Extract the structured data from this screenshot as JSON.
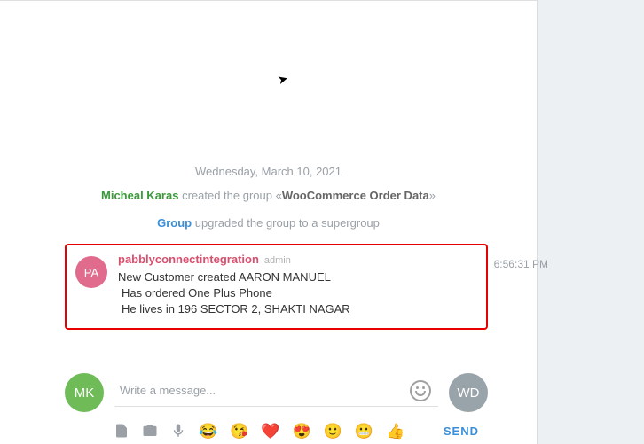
{
  "date_label": "Wednesday, March 10, 2021",
  "service1": {
    "actor": "Micheal Karas",
    "text_left": " created the group «",
    "group": "WooCommerce Order Data",
    "text_right": "»"
  },
  "service2": {
    "actor": "Group",
    "text": " upgraded the group to a supergroup"
  },
  "message": {
    "avatar_initials": "PA",
    "username": "pabblyconnectintegration",
    "badge": "admin",
    "time": "6:56:31 PM",
    "line1": "New Customer created AARON MANUEL",
    "line2": "Has ordered One Plus Phone",
    "line3": "He lives in 196 SECTOR 2, SHAKTI NAGAR"
  },
  "input": {
    "placeholder": "Write a message..."
  },
  "avatars": {
    "left": "MK",
    "right": "WD"
  },
  "emoji_bar": [
    "😂",
    "😘",
    "❤️",
    "😍",
    "🙂",
    "😬",
    "👍"
  ],
  "send_label": "SEND"
}
